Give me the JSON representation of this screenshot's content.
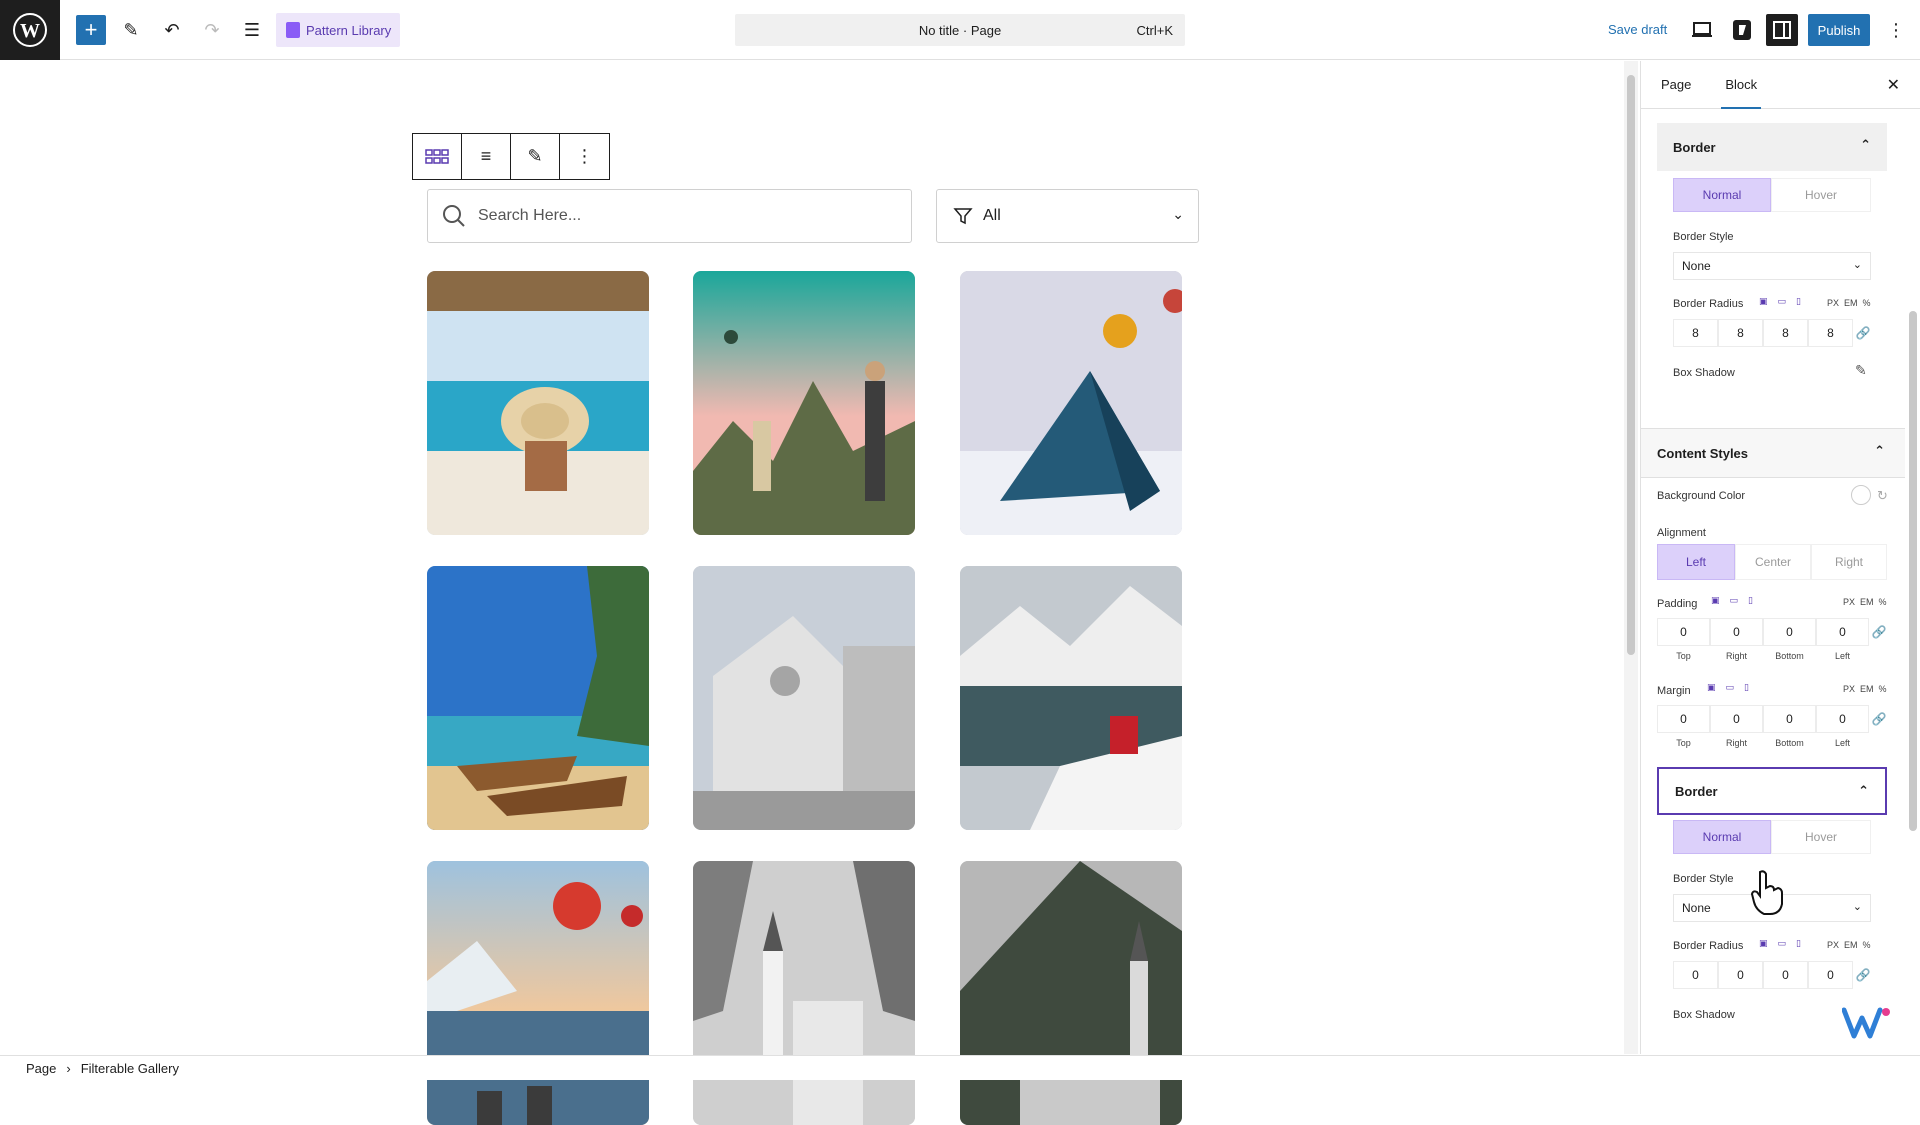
{
  "topbar": {
    "pattern_library": "Pattern Library",
    "doc_title": "No title · Page",
    "shortcut": "Ctrl+K",
    "save_draft": "Save draft",
    "publish": "Publish"
  },
  "canvas": {
    "search_placeholder": "Search Here...",
    "filter_value": "All"
  },
  "statusbar": {
    "crumbs": [
      "Page",
      "Filterable Gallery"
    ]
  },
  "sidebar": {
    "tabs": [
      "Page",
      "Block"
    ],
    "border1": {
      "title": "Border",
      "normal": "Normal",
      "hover": "Hover",
      "border_style_label": "Border Style",
      "border_style_value": "None",
      "border_radius_label": "Border Radius",
      "units": [
        "PX",
        "EM",
        "%"
      ],
      "radius": [
        "8",
        "8",
        "8",
        "8"
      ],
      "box_shadow": "Box Shadow"
    },
    "content_styles": {
      "title": "Content Styles",
      "bg_color_label": "Background Color",
      "alignment_label": "Alignment",
      "align_options": [
        "Left",
        "Center",
        "Right"
      ],
      "padding_label": "Padding",
      "padding": [
        "0",
        "0",
        "0",
        "0"
      ],
      "margin_label": "Margin",
      "margin": [
        "0",
        "0",
        "0",
        "0"
      ],
      "sides": [
        "Top",
        "Right",
        "Bottom",
        "Left"
      ],
      "units": [
        "PX",
        "EM",
        "%"
      ]
    },
    "border2": {
      "title": "Border",
      "normal": "Normal",
      "hover": "Hover",
      "border_style_label": "Border Style",
      "border_style_value": "None",
      "border_radius_label": "Border Radius",
      "units": [
        "PX",
        "EM",
        "%"
      ],
      "radius": [
        "0",
        "0",
        "0",
        "0"
      ],
      "box_shadow": "Box Shadow"
    }
  },
  "colors": {
    "wp_blue": "#2271b1",
    "accent_purple": "#5a3bb0",
    "segment_active": "#dcd0fa"
  }
}
